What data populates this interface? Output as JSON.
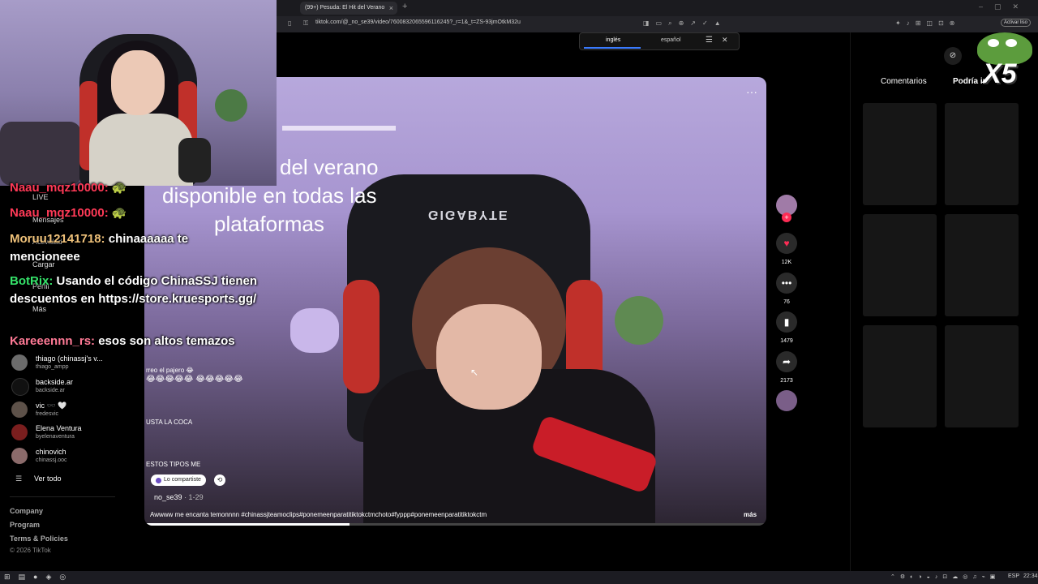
{
  "browser": {
    "tab_title": "(99+) Pesuda: El Hit del Verano",
    "url": "tiktok.com/@_no_se39/video/7600832065596116245?_r=1&_t=ZS-93jmOtkM32u",
    "activate_label": "Activar liso"
  },
  "translate": {
    "lang_from": "inglés",
    "lang_to": "español"
  },
  "video": {
    "overlay_line1": "del verano",
    "overlay_line2": "disponible en todas las",
    "overlay_line3": "plataformas",
    "chair_brand": "GIGABYTE",
    "inner_chat_a": "rreo el pajero 😂",
    "inner_chat_b": "😂😂😂😂😂 😂😂😂😂😂",
    "inner_chat_c": "USTA LA COCA",
    "inner_chat_d": "ESTOS TIPOS ME",
    "shared_label": "Lo compartiste",
    "author": "no_se39",
    "duration": "· 1-29",
    "caption": "Awwww me encanta temonnnn #chinassjteamoclips#ponemeenparatitiktokctmchoto#fyppp#ponemeenparatitiktokctm",
    "more_label": "más",
    "progress": 0.33
  },
  "actions": {
    "likes": "12K",
    "comments": "76",
    "saves": "1479",
    "shares": "2173"
  },
  "right_panel": {
    "tab_comments": "Comentarios",
    "tab_might_like": "Podría in",
    "badge": "X5"
  },
  "sidebar": {
    "live": "LIVE",
    "messages": "Mensajes",
    "activity": "Actividad",
    "upload": "Cargar",
    "profile": "Perfil",
    "more": "Más",
    "accounts": [
      {
        "name": "thiago (chinassj's v...",
        "handle": "thiago_ampp"
      },
      {
        "name": "backside.ar",
        "handle": "backside.ar"
      },
      {
        "name": "vic 🕶️ 🤍",
        "handle": "fredesvic"
      },
      {
        "name": "Elena Ventura",
        "handle": "byelenaventura"
      },
      {
        "name": "chinovich",
        "handle": "chinassj.ooc"
      }
    ],
    "see_all": "Ver todo",
    "footer": {
      "company": "Company",
      "program": "Program",
      "terms": "Terms & Policies",
      "copyright": "© 2026 TikTok"
    }
  },
  "chat": [
    {
      "user": "Naau_mqz10000:",
      "text": "🐢"
    },
    {
      "user": "Naau_mqz10000:",
      "text": "🐢"
    },
    {
      "user": "Moruu12141718:",
      "text": "chinaaaaaa te mencioneee"
    },
    {
      "user": "BotRix:",
      "text": "Usando el código ChinaSSJ tienen descuentos en https://store.kruesports.gg/"
    },
    {
      "user": "Kareeennn_rs:",
      "text": "esos son altos temazos"
    }
  ],
  "taskbar": {
    "lang": "ESP",
    "time": "22:34"
  },
  "colors": {
    "accent": "#fe2c55",
    "chat_red": "#ff3a57",
    "chat_gold": "#f0c27a",
    "chat_green": "#35e36a"
  },
  "icons": [
    "bookmark-icon",
    "lock-icon",
    "heart-icon",
    "comment-icon",
    "save-icon",
    "share-icon",
    "more-icon",
    "menu-icon",
    "close-icon",
    "repost-icon",
    "windows-icon",
    "cursor-icon"
  ]
}
